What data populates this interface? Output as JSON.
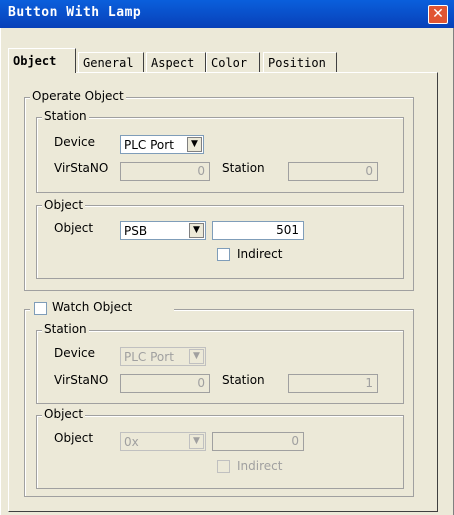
{
  "window": {
    "title": "Button With Lamp",
    "close_symbol": "✕"
  },
  "tabs": [
    {
      "label": "Object",
      "active": true
    },
    {
      "label": "General"
    },
    {
      "label": "Aspect"
    },
    {
      "label": "Color"
    },
    {
      "label": "Position"
    }
  ],
  "operate": {
    "legend": "Operate Object",
    "station": {
      "legend": "Station",
      "device_label": "Device",
      "device_value": "PLC Port",
      "virstano_label": "VirStaNO",
      "virstano_value": "0",
      "station_label": "Station",
      "station_value": "0"
    },
    "object": {
      "legend": "Object",
      "object_label": "Object",
      "type_value": "PSB",
      "address_value": "501",
      "indirect_label": "Indirect"
    }
  },
  "watch": {
    "legend": "Watch Object",
    "enabled": false,
    "station": {
      "legend": "Station",
      "device_label": "Device",
      "device_value": "PLC Port",
      "virstano_label": "VirStaNO",
      "virstano_value": "0",
      "station_label": "Station",
      "station_value": "1"
    },
    "object": {
      "legend": "Object",
      "object_label": "Object",
      "type_value": "0x",
      "address_value": "0",
      "indirect_label": "Indirect"
    }
  },
  "icons": {
    "dropdown_arrow": "▼"
  }
}
